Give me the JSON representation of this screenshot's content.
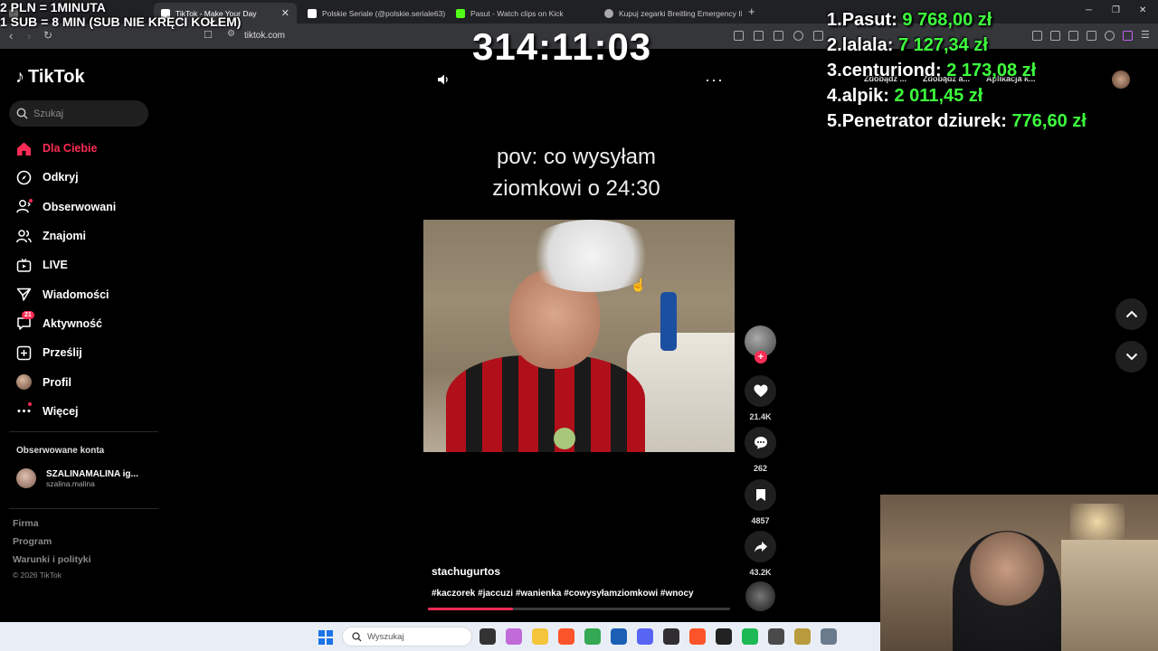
{
  "browser": {
    "tabs": [
      {
        "title": "",
        "active": false,
        "color": "#666666"
      },
      {
        "title": "TikTok - Make Your Day",
        "active": true,
        "color": "#ffffff"
      },
      {
        "title": "Polskie Seriale (@polskie.seriale63) |",
        "active": false,
        "color": "#ffffff"
      },
      {
        "title": "Pasut - Watch clips on Kick",
        "active": false,
        "color": "#53fc18"
      },
      {
        "title": "Kupuj zegarki Breitling Emergency II",
        "active": false,
        "color": "#aaaaaa"
      }
    ],
    "new_tab_label": "+",
    "url": "tiktok.com"
  },
  "stream_overlay": {
    "donate_info_line1": "2 PLN = 1MINUTA",
    "donate_info_line2": "1 SUB = 8 MIN (SUB NIE KRĘCI KOŁEM)",
    "timer": "314:11:03",
    "leaderboard": [
      {
        "rank": "1.",
        "name": "Pasut:",
        "amount": "9 768,00 zł"
      },
      {
        "rank": "2.",
        "name": "lalala:",
        "amount": "7 127,34 zł"
      },
      {
        "rank": "3.",
        "name": "centuriond:",
        "amount": "2 173,08 zł"
      },
      {
        "rank": "4.",
        "name": "alpik:",
        "amount": "2 011,45 zł"
      },
      {
        "rank": "5.",
        "name": "Penetrator dziurek:",
        "amount": "776,60 zł"
      }
    ]
  },
  "extensions": {
    "items": [
      "Zdobądź ...",
      "Zdobądź a...",
      "Aplikacja k..."
    ]
  },
  "tiktok": {
    "logo_text": "TikTok",
    "search_placeholder": "Szukaj",
    "nav": [
      {
        "label": "Dla Ciebie",
        "icon": "home-icon",
        "active": true
      },
      {
        "label": "Odkryj",
        "icon": "compass-icon",
        "active": false
      },
      {
        "label": "Obserwowani",
        "icon": "following-icon",
        "active": false
      },
      {
        "label": "Znajomi",
        "icon": "friends-icon",
        "active": false
      },
      {
        "label": "LIVE",
        "icon": "live-icon",
        "active": false
      },
      {
        "label": "Wiadomości",
        "icon": "messages-icon",
        "active": false
      },
      {
        "label": "Aktywność",
        "icon": "activity-icon",
        "active": false,
        "badge": "21"
      },
      {
        "label": "Prześlij",
        "icon": "upload-icon",
        "active": false
      },
      {
        "label": "Profil",
        "icon": "profile-avatar",
        "active": false
      },
      {
        "label": "Więcej",
        "icon": "more-icon",
        "active": false
      }
    ],
    "followed_title": "Obserwowane konta",
    "followed_accounts": [
      {
        "name": "SZALINAMALINA ig...",
        "handle": "szalina.malina"
      }
    ],
    "footer_links": [
      "Firma",
      "Program",
      "Warunki i polityki"
    ],
    "copyright": "© 2026 TikTok"
  },
  "video": {
    "caption_line1": "pov: co wysyłam",
    "caption_line2": "ziomkowi o 24:30",
    "username": "stachugurtos",
    "hashtags": "#kaczorek #jaccuzi #wanienka #cowysyłamziomkowi #wnocy",
    "likes": "21.4K",
    "comments": "262",
    "saves": "4857",
    "shares": "43.2K",
    "progress_fraction": 0.28,
    "accent_color": "#fe2c55"
  },
  "taskbar": {
    "search_placeholder": "Wyszukaj",
    "apps": [
      {
        "name": "task-view",
        "color": "#333333"
      },
      {
        "name": "copilot",
        "color": "#c06bd8"
      },
      {
        "name": "file-explorer",
        "color": "#f4c43b"
      },
      {
        "name": "brave",
        "color": "#fb542b"
      },
      {
        "name": "chrome",
        "color": "#34a853"
      },
      {
        "name": "store",
        "color": "#1a5fb4"
      },
      {
        "name": "discord",
        "color": "#5865f2"
      },
      {
        "name": "obs",
        "color": "#302e31"
      },
      {
        "name": "brave-active",
        "color": "#fb542b"
      },
      {
        "name": "app-dark",
        "color": "#222222"
      },
      {
        "name": "spotify",
        "color": "#1db954"
      },
      {
        "name": "calculator",
        "color": "#4a4a4a"
      },
      {
        "name": "app-gold",
        "color": "#b89b3c"
      },
      {
        "name": "settings",
        "color": "#6b7b8c"
      }
    ]
  }
}
